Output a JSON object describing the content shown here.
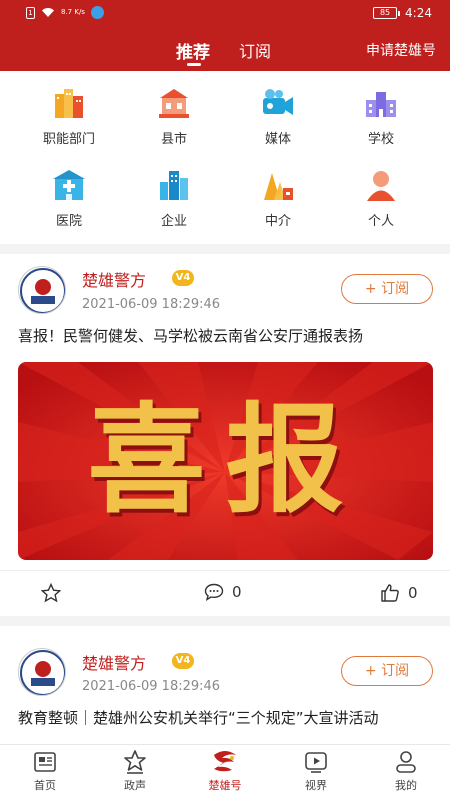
{
  "status": {
    "left": "8.7 K/s",
    "sim": "1",
    "time": "4:24",
    "battery": "85"
  },
  "header": {
    "tabs": [
      {
        "label": "推荐"
      },
      {
        "label": "订阅"
      }
    ],
    "apply_label": "申请楚雄号"
  },
  "categories": [
    {
      "label": "职能部门",
      "icon": "government-building-icon"
    },
    {
      "label": "县市",
      "icon": "city-hall-icon"
    },
    {
      "label": "媒体",
      "icon": "camera-icon"
    },
    {
      "label": "学校",
      "icon": "school-icon"
    },
    {
      "label": "医院",
      "icon": "hospital-icon"
    },
    {
      "label": "企业",
      "icon": "office-buildings-icon"
    },
    {
      "label": "中介",
      "icon": "agency-icon"
    },
    {
      "label": "个人",
      "icon": "person-icon"
    }
  ],
  "posts": [
    {
      "author": "楚雄警方",
      "badge": "V4",
      "date": "2021-06-09 18:29:46",
      "subscribe_label": "+ 订阅",
      "title": "喜报！民警何健发、马学松被云南省公安厅通报表扬",
      "banner_text": "喜报",
      "comments": "0",
      "likes": "0",
      "avatar_text": "楚雄警方"
    },
    {
      "author": "楚雄警方",
      "badge": "V4",
      "date": "2021-06-09 18:29:46",
      "subscribe_label": "+ 订阅",
      "title": "教育整顿｜楚雄州公安机关举行“三个规定”大宣讲活动",
      "avatar_text": "楚雄警方"
    }
  ],
  "bottom_nav": [
    {
      "label": "首页"
    },
    {
      "label": "政声"
    },
    {
      "label": "楚雄号"
    },
    {
      "label": "视界"
    },
    {
      "label": "我的"
    }
  ],
  "colors": {
    "brand_red": "#bf1f1d",
    "accent_orange": "#e07a3c",
    "badge_gold": "#f2b51c"
  }
}
